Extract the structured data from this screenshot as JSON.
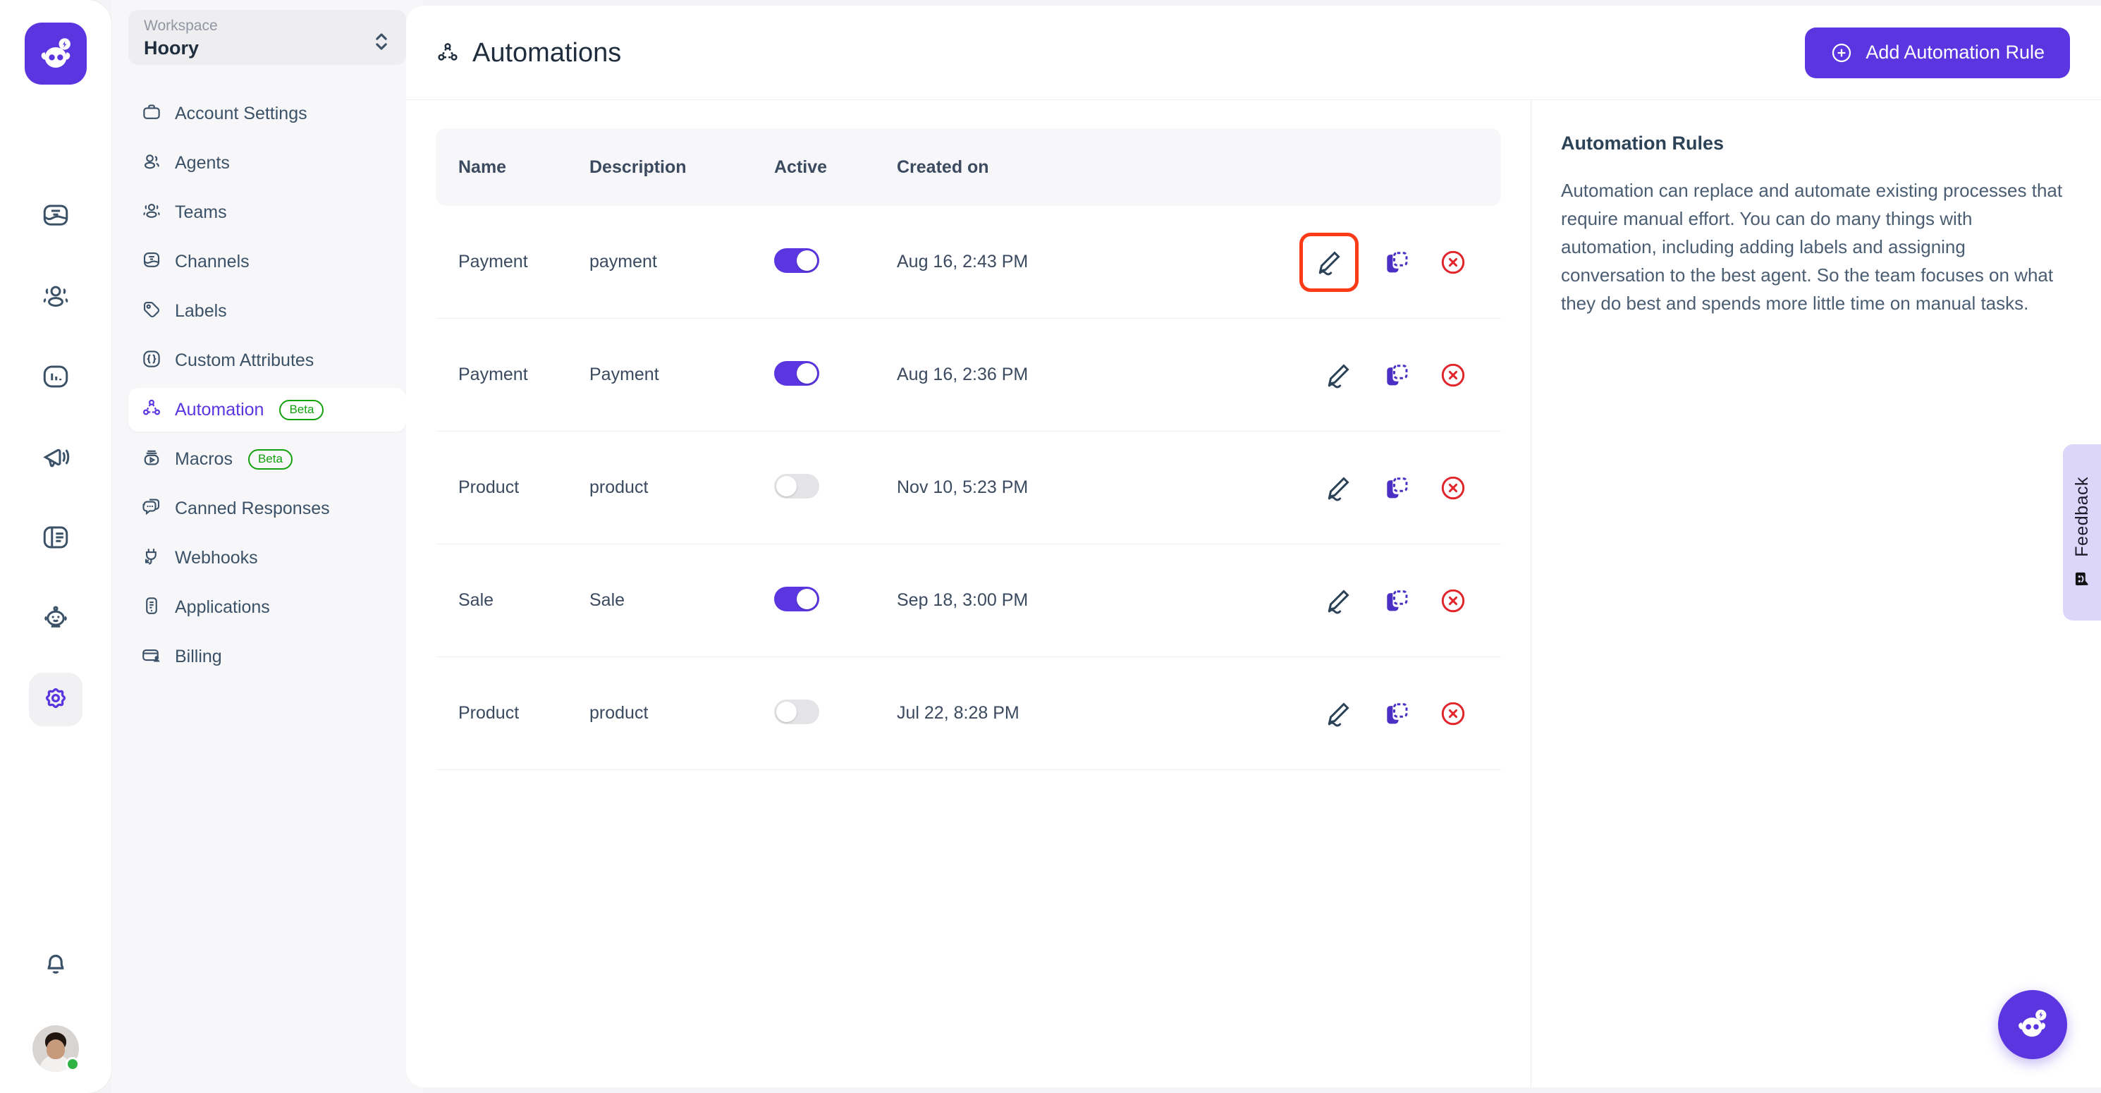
{
  "rail": {
    "logo_icon": "hoory-mascot-logo",
    "items": [
      {
        "icon": "conversations-icon",
        "name": "conversations",
        "active": false
      },
      {
        "icon": "contacts-icon",
        "name": "contacts",
        "active": false
      },
      {
        "icon": "reports-icon",
        "name": "reports",
        "active": false
      },
      {
        "icon": "campaigns-icon",
        "name": "campaigns",
        "active": false
      },
      {
        "icon": "knowledge-base-icon",
        "name": "knowledge-base",
        "active": false
      },
      {
        "icon": "bot-icon",
        "name": "bot",
        "active": false
      },
      {
        "icon": "gear-icon",
        "name": "settings",
        "active": true
      }
    ],
    "notifications_icon": "bell-icon",
    "avatar_name": "user-avatar",
    "status": "online"
  },
  "sidebar": {
    "workspace_label": "Workspace",
    "workspace_name": "Hoory",
    "items": [
      {
        "label": "Account Settings",
        "icon": "briefcase-icon",
        "active": false,
        "badge": ""
      },
      {
        "label": "Agents",
        "icon": "agents-icon",
        "active": false,
        "badge": ""
      },
      {
        "label": "Teams",
        "icon": "teams-icon",
        "active": false,
        "badge": ""
      },
      {
        "label": "Channels",
        "icon": "channels-icon",
        "active": false,
        "badge": ""
      },
      {
        "label": "Labels",
        "icon": "label-tag-icon",
        "active": false,
        "badge": ""
      },
      {
        "label": "Custom Attributes",
        "icon": "braces-icon",
        "active": false,
        "badge": ""
      },
      {
        "label": "Automation",
        "icon": "automation-icon",
        "active": true,
        "badge": "Beta"
      },
      {
        "label": "Macros",
        "icon": "macros-icon",
        "active": false,
        "badge": "Beta"
      },
      {
        "label": "Canned Responses",
        "icon": "canned-responses-icon",
        "active": false,
        "badge": ""
      },
      {
        "label": "Webhooks",
        "icon": "webhook-plug-icon",
        "active": false,
        "badge": ""
      },
      {
        "label": "Applications",
        "icon": "applications-icon",
        "active": false,
        "badge": ""
      },
      {
        "label": "Billing",
        "icon": "billing-card-icon",
        "active": false,
        "badge": ""
      }
    ]
  },
  "header": {
    "title": "Automations",
    "title_icon": "automation-icon",
    "add_button_label": "Add Automation Rule",
    "add_button_icon": "plus-circle-icon"
  },
  "table": {
    "columns": [
      "Name",
      "Description",
      "Active",
      "Created on"
    ],
    "rows": [
      {
        "name": "Payment",
        "description": "payment",
        "active": true,
        "created_on": "Aug 16, 2:43 PM",
        "edit_highlighted": true
      },
      {
        "name": "Payment",
        "description": "Payment",
        "active": true,
        "created_on": "Aug 16, 2:36 PM",
        "edit_highlighted": false
      },
      {
        "name": "Product",
        "description": "product",
        "active": false,
        "created_on": "Nov 10, 5:23 PM",
        "edit_highlighted": false
      },
      {
        "name": "Sale",
        "description": "Sale",
        "active": true,
        "created_on": "Sep 18, 3:00 PM",
        "edit_highlighted": false
      },
      {
        "name": "Product",
        "description": "product",
        "active": false,
        "created_on": "Jul 22, 8:28 PM",
        "edit_highlighted": false
      }
    ],
    "action_icons": {
      "edit": "pencil-edit-icon",
      "clone": "clone-copy-icon",
      "delete": "delete-x-circle-icon"
    }
  },
  "info_panel": {
    "title": "Automation Rules",
    "body": "Automation can replace and automate existing processes that require manual effort. You can do many things with automation, including adding labels and assigning conversation to the best agent. So the team focuses on what they do best and spends more little time on manual tasks."
  },
  "feedback": {
    "label": "Feedback",
    "icon": "smiley-feedback-icon"
  },
  "fab": {
    "icon": "hoory-chat-bubble-icon"
  },
  "colors": {
    "accent": "#5a35e0",
    "beta_badge": "#13a10e",
    "danger": "#e0252b",
    "highlight_box": "#fb3b17",
    "text_dark": "#1f2d3d",
    "text_body": "#4a5d72",
    "feedback_bg": "#dcd6fb",
    "status_online": "#2fb344"
  }
}
